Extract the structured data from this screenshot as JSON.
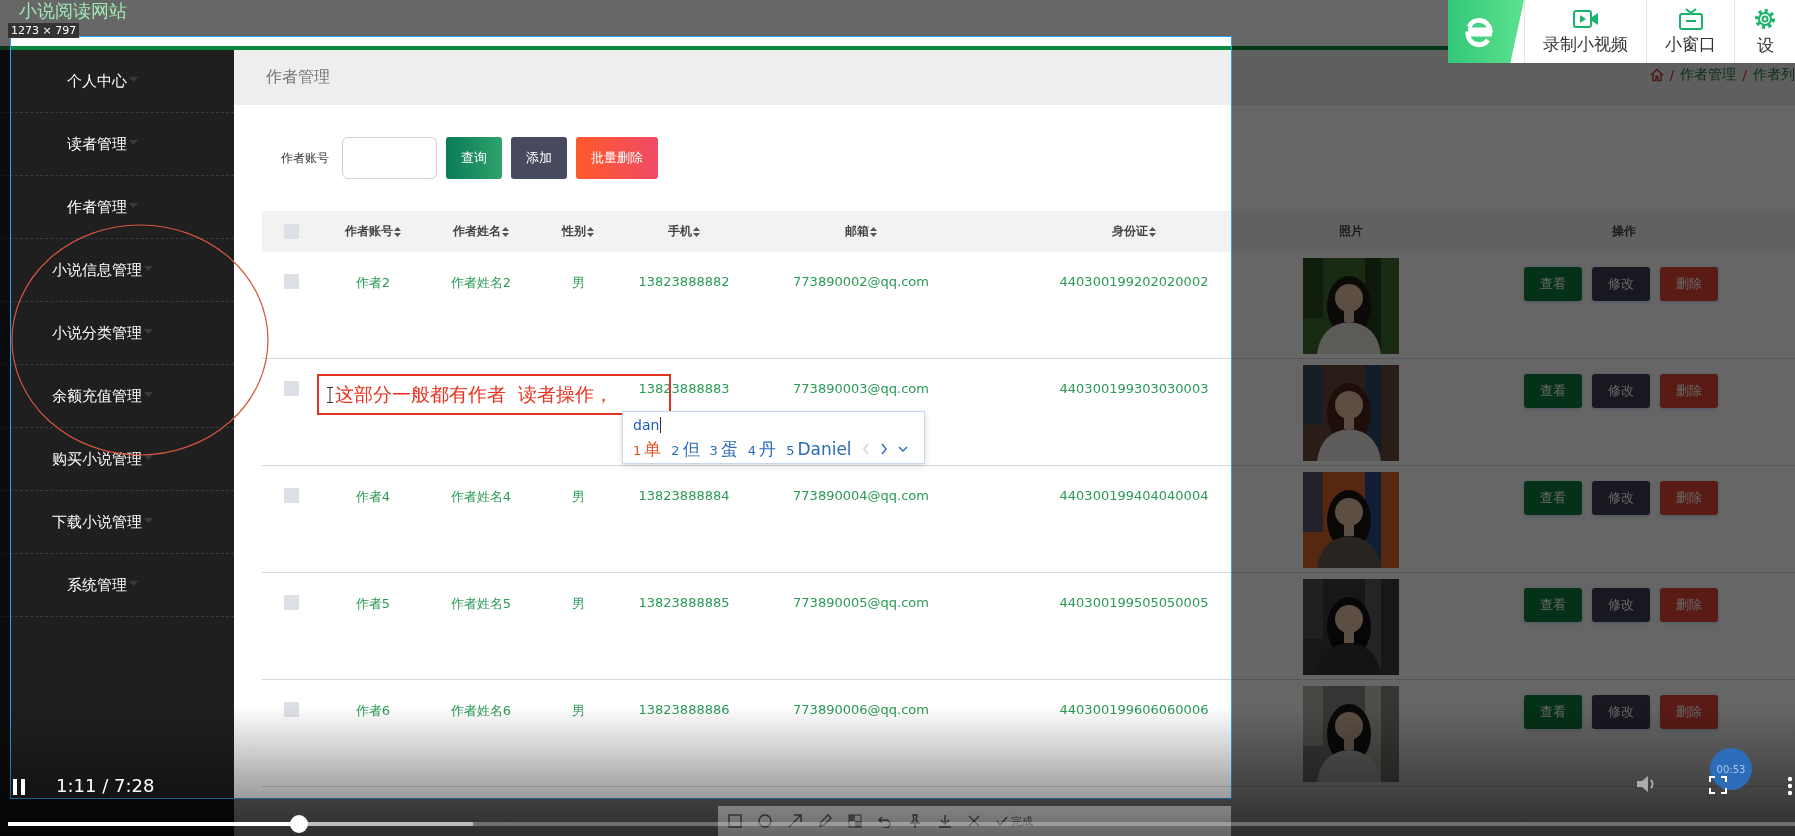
{
  "site_title": "小说阅读网站",
  "capture": {
    "size_label": "1273 × 797",
    "finish_label": "完成"
  },
  "recorder_toolbar": {
    "items": [
      {
        "kind": "record",
        "label": "录制小视频"
      },
      {
        "kind": "mini",
        "label": "小窗口"
      },
      {
        "kind": "settings",
        "label": "设"
      }
    ]
  },
  "sidebar": {
    "items": [
      {
        "label": "个人中心"
      },
      {
        "label": "读者管理"
      },
      {
        "label": "作者管理"
      },
      {
        "label": "小说信息管理"
      },
      {
        "label": "小说分类管理"
      },
      {
        "label": "余额充值管理"
      },
      {
        "label": "购买小说管理"
      },
      {
        "label": "下载小说管理"
      },
      {
        "label": "系统管理"
      }
    ]
  },
  "page": {
    "title": "作者管理",
    "breadcrumb": [
      {
        "separator": "/",
        "label": "作者管理"
      },
      {
        "separator": "/",
        "label": "作者列"
      }
    ]
  },
  "search": {
    "label": "作者账号",
    "buttons": [
      {
        "kind": "primary",
        "label": "查询"
      },
      {
        "kind": "dark",
        "label": "添加"
      },
      {
        "kind": "danger",
        "label": "批量删除"
      }
    ]
  },
  "table": {
    "header_checked": false,
    "columns": [
      {
        "label": "作者账号",
        "sortable": true
      },
      {
        "label": "作者姓名",
        "sortable": true
      },
      {
        "label": "性别",
        "sortable": true
      },
      {
        "label": "手机",
        "sortable": true
      },
      {
        "label": "邮箱",
        "sortable": true
      },
      {
        "label": "身份证",
        "sortable": true
      },
      {
        "label": "照片",
        "sortable": false
      },
      {
        "label": "操作",
        "sortable": false
      }
    ],
    "rows": [
      {
        "checked": false,
        "account": "作者2",
        "name": "作者姓名2",
        "gender": "男",
        "phone": "13823888882",
        "email": "773890002@qq.com",
        "id_card": "440300199202020002",
        "actions": [
          {
            "kind": "view",
            "label": "查看"
          },
          {
            "kind": "edit",
            "label": "修改"
          },
          {
            "kind": "delete",
            "label": "删除"
          }
        ]
      },
      {
        "checked": false,
        "phone": "13823888883",
        "email": "773890003@qq.com",
        "id_card": "440300199303030003",
        "actions": [
          {
            "kind": "view",
            "label": "查看"
          },
          {
            "kind": "edit",
            "label": "修改"
          },
          {
            "kind": "delete",
            "label": "删除"
          }
        ]
      },
      {
        "checked": false,
        "account": "作者4",
        "name": "作者姓名4",
        "gender": "男",
        "phone": "13823888884",
        "email": "773890004@qq.com",
        "id_card": "440300199404040004",
        "actions": [
          {
            "kind": "view",
            "label": "查看"
          },
          {
            "kind": "edit",
            "label": "修改"
          },
          {
            "kind": "delete",
            "label": "删除"
          }
        ]
      },
      {
        "checked": false,
        "account": "作者5",
        "name": "作者姓名5",
        "gender": "男",
        "phone": "13823888885",
        "email": "773890005@qq.com",
        "id_card": "440300199505050005",
        "actions": [
          {
            "kind": "view",
            "label": "查看"
          },
          {
            "kind": "edit",
            "label": "修改"
          },
          {
            "kind": "delete",
            "label": "删除"
          }
        ]
      },
      {
        "checked": false,
        "account": "作者6",
        "name": "作者姓名6",
        "gender": "男",
        "phone": "13823888886",
        "email": "773890006@qq.com",
        "id_card": "440300199606060006",
        "actions": [
          {
            "kind": "view",
            "label": "查看"
          },
          {
            "kind": "edit",
            "label": "修改"
          },
          {
            "kind": "delete",
            "label": "删除"
          }
        ]
      }
    ]
  },
  "annotation": {
    "text": "这部分一般都有作者  读者操作，"
  },
  "ime": {
    "input": "dan",
    "candidates": [
      {
        "index": "1",
        "text": "单",
        "selected": true
      },
      {
        "index": "2",
        "text": "但",
        "selected": false
      },
      {
        "index": "3",
        "text": "蛋",
        "selected": false
      },
      {
        "index": "4",
        "text": "丹",
        "selected": false
      },
      {
        "index": "5",
        "text": "Daniel",
        "selected": false
      }
    ]
  },
  "player": {
    "playing": true,
    "time": "1:11 / 7:28",
    "progress": {
      "level": 0.163
    },
    "buffered": {
      "level": 0.26
    },
    "badge": "00:53"
  }
}
